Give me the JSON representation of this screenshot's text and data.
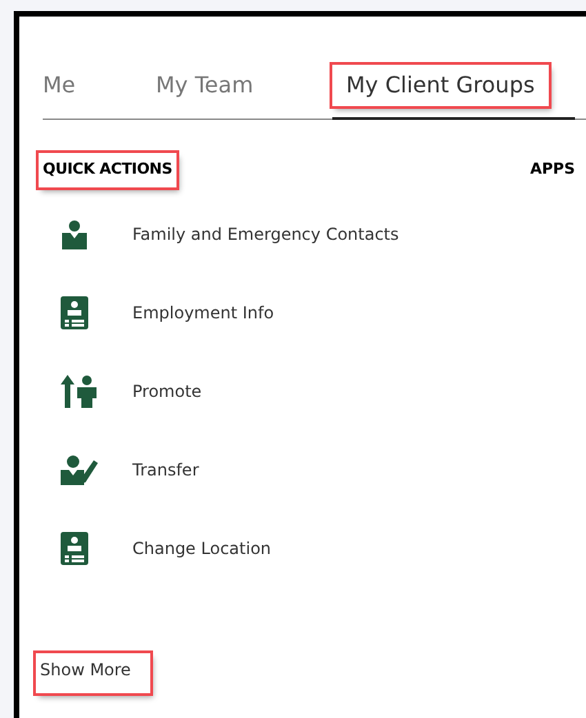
{
  "tabs": [
    {
      "label": "Me",
      "selected": false,
      "highlighted": false
    },
    {
      "label": "My Team",
      "selected": false,
      "highlighted": false
    },
    {
      "label": "My Client Groups",
      "selected": true,
      "highlighted": true
    }
  ],
  "quick_actions": {
    "heading": "QUICK ACTIONS",
    "highlighted": true,
    "items": [
      {
        "label": "Family and Emergency Contacts",
        "kind": "person"
      },
      {
        "label": "Employment Info",
        "kind": "badge"
      },
      {
        "label": "Promote",
        "kind": "promote"
      },
      {
        "label": "Transfer",
        "kind": "transfer"
      },
      {
        "label": "Change Location",
        "kind": "badge"
      }
    ]
  },
  "apps": {
    "heading": "APPS"
  },
  "show_more": {
    "label": "Show More",
    "highlighted": true
  }
}
